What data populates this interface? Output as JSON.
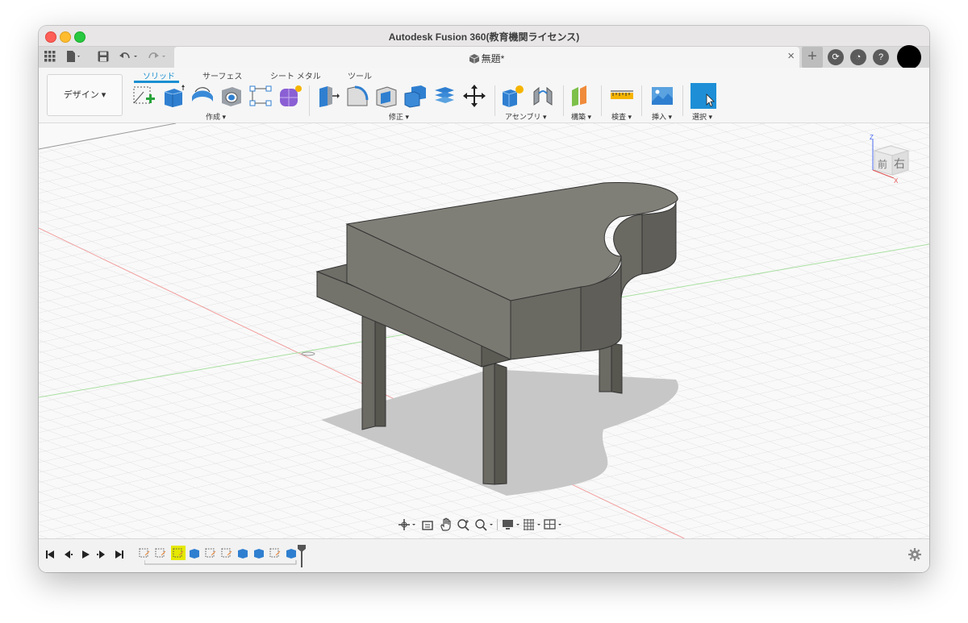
{
  "window": {
    "title": "Autodesk Fusion 360(教育機関ライセンス)"
  },
  "tabbar": {
    "doc_title": "無題*",
    "close": "×",
    "plus": "+"
  },
  "workspace": {
    "label": "デザイン ▾"
  },
  "toolbar_tabs": [
    "ソリッド",
    "サーフェス",
    "シート メタル",
    "ツール"
  ],
  "groups": {
    "create": "作成 ▾",
    "modify": "修正 ▾",
    "assemble": "アセンブリ ▾",
    "construct": "構築 ▾",
    "inspect": "検査 ▾",
    "insert": "挿入 ▾",
    "select": "選択 ▾"
  },
  "viewcube": {
    "front": "前",
    "right": "右",
    "z_axis": "Z",
    "x_axis": "X"
  },
  "colors": {
    "accent": "#1a8fd0",
    "select_tool": "#1e8fd6",
    "model": "#6e6d66",
    "highlight": "#e5e800"
  },
  "icons": {
    "grid_menu": "grid-icon",
    "file": "file-icon",
    "save": "save-icon",
    "undo": "undo-icon",
    "redo": "redo-icon",
    "settings": "gear-icon"
  }
}
